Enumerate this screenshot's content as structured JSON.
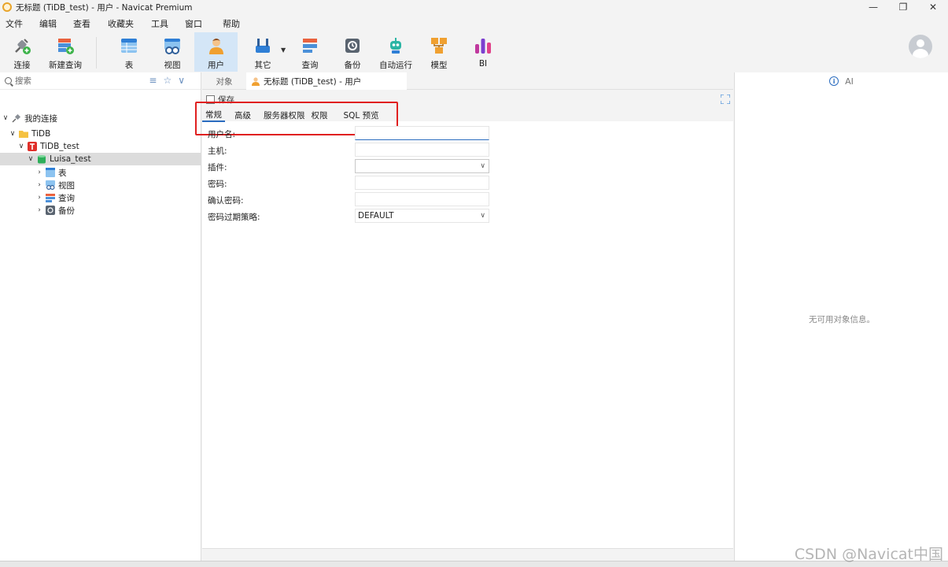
{
  "window": {
    "title": "无标题 (TiDB_test) - 用户 - Navicat Premium",
    "controls": [
      "minimize",
      "restore",
      "close"
    ]
  },
  "menu": [
    "文件",
    "编辑",
    "查看",
    "收藏夹",
    "工具",
    "窗口",
    "帮助"
  ],
  "toolbar": {
    "items": [
      {
        "label": "连接",
        "icon": "connect-icon"
      },
      {
        "label": "新建查询",
        "icon": "new-query-icon"
      },
      {
        "label": "表",
        "icon": "table-icon"
      },
      {
        "label": "视图",
        "icon": "view-icon"
      },
      {
        "label": "用户",
        "icon": "user-icon",
        "active": true
      },
      {
        "label": "其它",
        "icon": "other-icon"
      },
      {
        "label": "查询",
        "icon": "query-icon"
      },
      {
        "label": "备份",
        "icon": "backup-icon"
      },
      {
        "label": "自动运行",
        "icon": "automation-icon"
      },
      {
        "label": "模型",
        "icon": "model-icon"
      },
      {
        "label": "BI",
        "icon": "bi-icon"
      }
    ]
  },
  "sidebar": {
    "search_placeholder": "搜索",
    "tree": [
      {
        "label": "我的连接",
        "level": 0,
        "expanded": true,
        "icon": "connections-icon"
      },
      {
        "label": "TiDB",
        "level": 1,
        "expanded": true,
        "icon": "folder-icon"
      },
      {
        "label": "TiDB_test",
        "level": 2,
        "expanded": true,
        "icon": "tidb-icon"
      },
      {
        "label": "Luisa_test",
        "level": 3,
        "expanded": true,
        "icon": "database-icon",
        "selected": true
      },
      {
        "label": "表",
        "level": 4,
        "expanded": false,
        "icon": "table-icon"
      },
      {
        "label": "视图",
        "level": 4,
        "expanded": false,
        "icon": "view-icon"
      },
      {
        "label": "查询",
        "level": 4,
        "expanded": false,
        "icon": "query-icon"
      },
      {
        "label": "备份",
        "level": 4,
        "expanded": false,
        "icon": "backup-icon"
      }
    ]
  },
  "editor": {
    "tabs": {
      "objects": "对象",
      "document": "无标题 (TiDB_test) - 用户"
    },
    "save_label": "保存",
    "subtabs": [
      "常规",
      "高级",
      "服务器权限",
      "权限",
      "SQL 预览"
    ],
    "fields": [
      {
        "label": "用户名:",
        "value": "",
        "type": "text"
      },
      {
        "label": "主机:",
        "value": "",
        "type": "text"
      },
      {
        "label": "插件:",
        "value": "",
        "type": "select"
      },
      {
        "label": "密码:",
        "value": "",
        "type": "text"
      },
      {
        "label": "确认密码:",
        "value": "",
        "type": "text"
      },
      {
        "label": "密码过期策略:",
        "value": "DEFAULT",
        "type": "select"
      }
    ]
  },
  "info_panel": {
    "ai_label": "AI",
    "empty_message": "无可用对象信息。"
  },
  "watermark": "CSDN @Navicat中国",
  "colors": {
    "accent": "#2a6cbf",
    "highlight_box": "#e02020",
    "active_tool": "#d4e6f7"
  }
}
